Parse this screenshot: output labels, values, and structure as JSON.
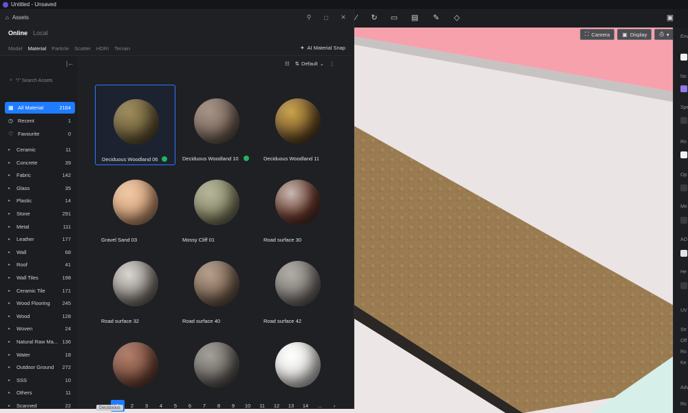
{
  "window": {
    "title": "Untitled - Unsaved"
  },
  "viewport_tools": {
    "camera": "Camera",
    "display": "Display"
  },
  "assets": {
    "title": "Assets",
    "source_tabs": [
      {
        "label": "Online",
        "active": true
      },
      {
        "label": "Local",
        "active": false
      }
    ],
    "type_tabs": [
      {
        "label": "Model",
        "active": false
      },
      {
        "label": "Material",
        "active": true
      },
      {
        "label": "Particle",
        "active": false
      },
      {
        "label": "Scatter",
        "active": false
      },
      {
        "label": "HDRI",
        "active": false
      },
      {
        "label": "Terrain",
        "active": false
      }
    ],
    "ai_snap": "AI Material Snap",
    "sort": "Default",
    "search_placeholder": "\"/\" Search Assets",
    "special": [
      {
        "label": "All Material",
        "count": "2164",
        "icon": "grid-icon",
        "active": true
      },
      {
        "label": "Recent",
        "count": "1",
        "icon": "clock-icon",
        "active": false
      },
      {
        "label": "Favourite",
        "count": "0",
        "icon": "heart-icon",
        "active": false
      }
    ],
    "categories": [
      {
        "label": "Ceramic",
        "count": "11"
      },
      {
        "label": "Concrete",
        "count": "39"
      },
      {
        "label": "Fabric",
        "count": "142"
      },
      {
        "label": "Glass",
        "count": "35"
      },
      {
        "label": "Plastic",
        "count": "14"
      },
      {
        "label": "Stone",
        "count": "291"
      },
      {
        "label": "Metal",
        "count": "111"
      },
      {
        "label": "Leather",
        "count": "177"
      },
      {
        "label": "Wall",
        "count": "68"
      },
      {
        "label": "Roof",
        "count": "41"
      },
      {
        "label": "Wall Tiles",
        "count": "198"
      },
      {
        "label": "Ceramic Tile",
        "count": "171"
      },
      {
        "label": "Wood Flooring",
        "count": "245"
      },
      {
        "label": "Wood",
        "count": "128"
      },
      {
        "label": "Woven",
        "count": "24"
      },
      {
        "label": "Natural Raw Ma...",
        "count": "136"
      },
      {
        "label": "Water",
        "count": "18"
      },
      {
        "label": "Outdoor Ground",
        "count": "272"
      },
      {
        "label": "SSS",
        "count": "10"
      },
      {
        "label": "Others",
        "count": "11"
      },
      {
        "label": "Scanned",
        "count": "22"
      }
    ],
    "materials": [
      {
        "name": "Deciduous Woodland 06",
        "downloaded": true,
        "selected": true,
        "colors": [
          "#9c8a5a",
          "#6e5f3a",
          "#4a3d22"
        ]
      },
      {
        "name": "Deciduous Woodland 10",
        "downloaded": true,
        "selected": false,
        "colors": [
          "#a59184",
          "#7d6a5e",
          "#4d3f37"
        ]
      },
      {
        "name": "Deciduous Woodland 11",
        "downloaded": false,
        "selected": false,
        "colors": [
          "#c9a34a",
          "#7a5a2a",
          "#2e2416"
        ]
      },
      {
        "name": "Gravel Sand 03",
        "downloaded": false,
        "selected": false,
        "colors": [
          "#efc8a4",
          "#d4a37c",
          "#9c7052"
        ]
      },
      {
        "name": "Mossy Cliff 01",
        "downloaded": false,
        "selected": false,
        "colors": [
          "#b5b59a",
          "#8a8a6a",
          "#56563f"
        ]
      },
      {
        "name": "Road surface 30",
        "downloaded": false,
        "selected": false,
        "colors": [
          "#c7b8b0",
          "#6a3d30",
          "#3a221c"
        ]
      },
      {
        "name": "Road surface 32",
        "downloaded": false,
        "selected": false,
        "colors": [
          "#d9d6d1",
          "#8d8781",
          "#4a4541"
        ]
      },
      {
        "name": "Road surface 40",
        "downloaded": false,
        "selected": false,
        "colors": [
          "#b59e8a",
          "#7d6756",
          "#4b3c31"
        ]
      },
      {
        "name": "Road surface 42",
        "downloaded": false,
        "selected": false,
        "colors": [
          "#b0aca6",
          "#7d7974",
          "#4a4744"
        ]
      },
      {
        "name": "",
        "downloaded": false,
        "selected": false,
        "colors": [
          "#b07d68",
          "#7d5040",
          "#4a2c22"
        ]
      },
      {
        "name": "",
        "downloaded": false,
        "selected": false,
        "colors": [
          "#a29f99",
          "#6d6964",
          "#3a3734"
        ]
      },
      {
        "name": "",
        "downloaded": false,
        "selected": false,
        "colors": [
          "#ffffff",
          "#e2e1de",
          "#a9a7a3"
        ]
      }
    ],
    "pagination": [
      "1",
      "2",
      "3",
      "4",
      "5",
      "6",
      "7",
      "8",
      "9",
      "10",
      "11",
      "12",
      "13",
      "14",
      "..."
    ],
    "current_page": "1"
  },
  "right_panel": {
    "labels": [
      "Env",
      "No",
      "Spe",
      "Ro",
      "Op",
      "Me",
      "AO",
      "He",
      "UV",
      "Str",
      "Off",
      "Ro",
      "Ke",
      "Adv",
      "Ro"
    ]
  },
  "status": {
    "chips": [
      "Deciduous"
    ]
  },
  "colors": {
    "accent": "#1f7cff",
    "check": "#25b35a",
    "scene_pink": "#f7a1ad",
    "scene_wall": "#ece6e6",
    "scene_mint": "#d7efe9"
  }
}
